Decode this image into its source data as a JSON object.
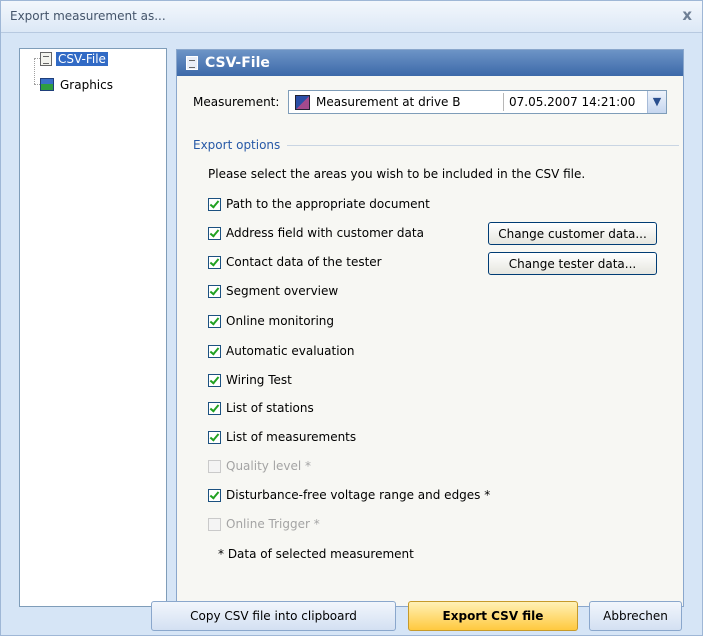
{
  "window": {
    "title": "Export measurement as...",
    "close_glyph": "x"
  },
  "tree": {
    "items": [
      {
        "label": "CSV-File",
        "icon": "csv-file-icon",
        "selected": true
      },
      {
        "label": "Graphics",
        "icon": "graphics-icon",
        "selected": false
      }
    ]
  },
  "panel": {
    "header": "CSV-File",
    "measurement_label": "Measurement:",
    "measurement": {
      "name": "Measurement at drive B",
      "datetime": "07.05.2007  14:21:00"
    },
    "group_label": "Export options",
    "instruction": "Please select the areas you wish to be included in the CSV file.",
    "options": [
      {
        "label": "Path to the appropriate document",
        "checked": true,
        "enabled": true
      },
      {
        "label": "Address field with customer data",
        "checked": true,
        "enabled": true
      },
      {
        "label": "Contact data of the tester",
        "checked": true,
        "enabled": true
      },
      {
        "label": "Segment overview",
        "checked": true,
        "enabled": true
      },
      {
        "label": "Online monitoring",
        "checked": true,
        "enabled": true
      },
      {
        "label": "Automatic evaluation",
        "checked": true,
        "enabled": true
      },
      {
        "label": "Wiring Test",
        "checked": true,
        "enabled": true
      },
      {
        "label": "List of stations",
        "checked": true,
        "enabled": true
      },
      {
        "label": "List of measurements",
        "checked": true,
        "enabled": true
      },
      {
        "label": "Quality level *",
        "checked": false,
        "enabled": false
      },
      {
        "label": "Disturbance-free voltage range and edges *",
        "checked": true,
        "enabled": true
      },
      {
        "label": "Online Trigger *",
        "checked": false,
        "enabled": false
      }
    ],
    "change_customer_label": "Change customer data...",
    "change_tester_label": "Change tester data...",
    "footnote": "* Data of selected measurement"
  },
  "buttons": {
    "copy": "Copy CSV file into clipboard",
    "export": "Export CSV file",
    "cancel": "Abbrechen"
  }
}
